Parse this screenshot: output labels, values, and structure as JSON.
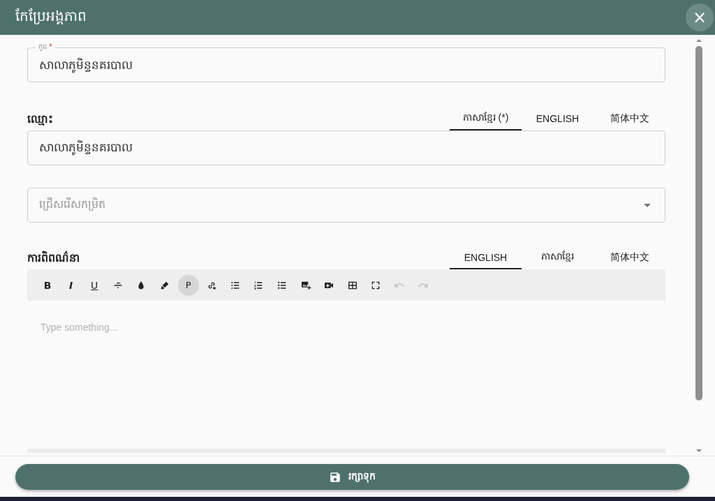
{
  "dialog": {
    "title": "កែប្រែអង្គភាព",
    "close_label": "×"
  },
  "code_field": {
    "label": "កូដ",
    "required_mark": "*",
    "value": "សាលាភូមិន្ទនគរបាល"
  },
  "name_section": {
    "label": "ឈ្មោះ",
    "tabs": [
      {
        "label": "ភាសាខ្មែរ (*)",
        "selected": true
      },
      {
        "label": "ENGLISH",
        "selected": false
      },
      {
        "label": "简体中文",
        "selected": false
      }
    ],
    "value": "សាលាភូមិន្ទនគរបាល"
  },
  "level_select": {
    "placeholder": "ជ្រើសរើសកម្រិត"
  },
  "description_section": {
    "label": "ការពិពណ៌នា",
    "tabs": [
      {
        "label": "ENGLISH",
        "selected": true
      },
      {
        "label": "ភាសាខ្មែរ",
        "selected": false
      },
      {
        "label": "简体中文",
        "selected": false
      }
    ],
    "toolbar": [
      {
        "kind": "bold",
        "label": "B",
        "active": false,
        "disabled": false
      },
      {
        "kind": "italic",
        "label": "I",
        "active": false,
        "disabled": false
      },
      {
        "kind": "underline",
        "label": "U",
        "active": false,
        "disabled": false
      },
      {
        "kind": "strike",
        "active": false,
        "disabled": false
      },
      {
        "kind": "color",
        "active": false,
        "disabled": false
      },
      {
        "kind": "highlight",
        "active": false,
        "disabled": false
      },
      {
        "kind": "paragraph",
        "label": "P",
        "active": true,
        "disabled": false
      },
      {
        "kind": "link",
        "active": false,
        "disabled": false
      },
      {
        "kind": "bullets",
        "active": false,
        "disabled": false
      },
      {
        "kind": "numbers",
        "active": false,
        "disabled": false
      },
      {
        "kind": "tasks",
        "active": false,
        "disabled": false
      },
      {
        "kind": "image",
        "active": false,
        "disabled": false
      },
      {
        "kind": "video",
        "active": false,
        "disabled": false
      },
      {
        "kind": "table",
        "active": false,
        "disabled": false
      },
      {
        "kind": "fullscreen",
        "active": false,
        "disabled": false
      },
      {
        "kind": "undo",
        "active": false,
        "disabled": true
      },
      {
        "kind": "redo",
        "active": false,
        "disabled": true
      }
    ],
    "editor_placeholder": "Type something..."
  },
  "save_button": {
    "label": "រក្សាទុក"
  }
}
